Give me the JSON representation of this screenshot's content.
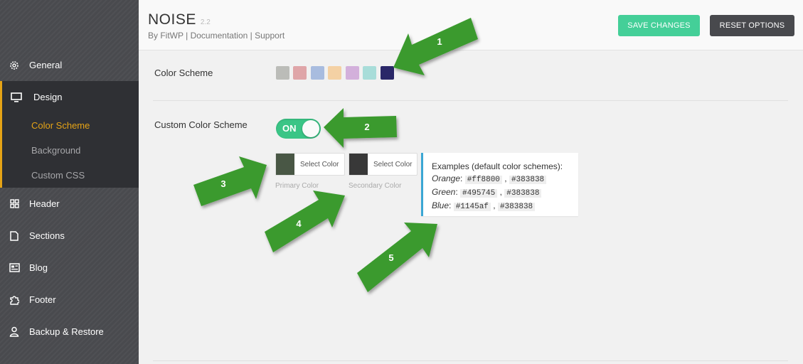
{
  "header": {
    "title": "NOISE",
    "version": "2.2",
    "byline": {
      "author": "By FitWP",
      "sep": "|",
      "documentation": "Documentation",
      "support": "Support"
    },
    "save_label": "SAVE CHANGES",
    "reset_label": "RESET OPTIONS"
  },
  "sidebar": {
    "items": [
      {
        "label": "General",
        "icon": "gear-icon"
      },
      {
        "label": "Design",
        "icon": "monitor-icon",
        "active": true
      },
      {
        "label": "Header",
        "icon": "grid-icon"
      },
      {
        "label": "Sections",
        "icon": "file-icon"
      },
      {
        "label": "Blog",
        "icon": "newspaper-icon"
      },
      {
        "label": "Footer",
        "icon": "puzzle-icon"
      },
      {
        "label": "Backup & Restore",
        "icon": "person-icon"
      }
    ],
    "subitems": [
      {
        "label": "Color Scheme",
        "current": true
      },
      {
        "label": "Background"
      },
      {
        "label": "Custom CSS"
      }
    ]
  },
  "color_scheme": {
    "label": "Color Scheme",
    "swatches": [
      "#bbbcb8",
      "#dfa5a8",
      "#a8bcdf",
      "#f4d1a4",
      "#d3b0db",
      "#a8ddd9",
      "#2a2768"
    ]
  },
  "custom_scheme": {
    "label": "Custom Color Scheme",
    "toggle": "ON",
    "primary": {
      "button": "Select Color",
      "label": "Primary Color",
      "color": "#495745"
    },
    "secondary": {
      "button": "Select Color",
      "label": "Secondary Color",
      "color": "#383838"
    },
    "examples": {
      "title": "Examples (default color schemes):",
      "rows": [
        {
          "name": "Orange",
          "c1": "#ff8800",
          "c2": "#383838"
        },
        {
          "name": "Green",
          "c1": "#495745",
          "c2": "#383838"
        },
        {
          "name": "Blue",
          "c1": "#1145af",
          "c2": "#383838"
        }
      ]
    }
  },
  "annotations": [
    "1",
    "2",
    "3",
    "4",
    "5"
  ],
  "colors": {
    "accent_green": "#44cf98",
    "sidebar_active": "#e5a316",
    "arrow_green": "#3a9a2e"
  }
}
